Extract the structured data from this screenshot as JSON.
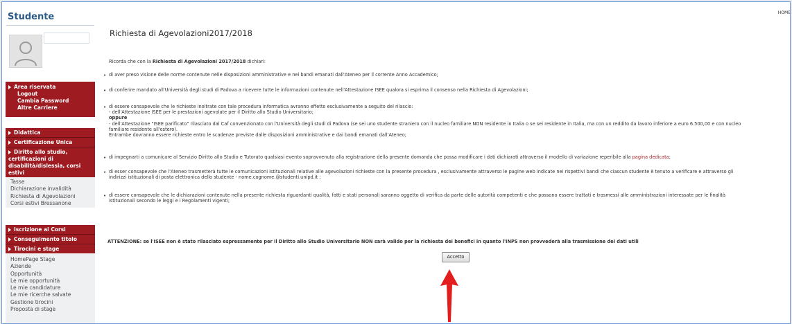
{
  "sidebar": {
    "title": "Studente",
    "area_riservata": {
      "label": "Area riservata",
      "items": [
        "Logout",
        "Cambia Password",
        "Altre Carriere"
      ]
    },
    "menu": [
      {
        "label": "Didattica"
      },
      {
        "label": "Certificazione Unica"
      },
      {
        "label": "Diritto allo studio, certificazioni di disabilità/dislessia, corsi estivi"
      }
    ],
    "diritto_items": [
      "Tasse",
      "Dichiarazione invalidità",
      "Richiesta di Agevolazioni",
      "Corsi estivi Bressanone"
    ],
    "menu2": [
      {
        "label": "Iscrizione ai Corsi"
      },
      {
        "label": "Conseguimento titolo"
      },
      {
        "label": "Tirocini e stage"
      }
    ],
    "tirocini_items": [
      "HomePage Stage",
      "Aziende",
      "Opportunità",
      "Le mie opportunità",
      "Le mie candidature",
      "Le mie ricerche salvate",
      "Gestione tirocini",
      "Proposta di stage"
    ]
  },
  "header": {
    "home": "HOME"
  },
  "main": {
    "title": "Richiesta di Agevolazioni2017/2018",
    "intro_prefix": "Ricorda che con la ",
    "intro_bold": "Richiesta di Agevolazioni 2017/2018",
    "intro_suffix": " dichiari:",
    "b1": "di aver preso visione delle norme contenute nelle disposizioni amministrative e nei bandi emanati dall'Ateneo per il corrente Anno Accademico;",
    "b2": "di conferire mandato all'Università degli studi di Padova a ricevere tutte le informazioni contenute nell'Attestazione ISEE qualora si esprima il consenso nella Richiesta di Agevolazioni;",
    "b3_l1": "di essere consapevole che le richieste inoltrate con tale procedura informatica avranno effetto esclusivamente a seguito del rilascio:",
    "b3_l2": "- dell'Attestazione ISEE per le prestazioni agevolate per il Diritto allo Studio Universitario;",
    "b3_l3": "oppure",
    "b3_l4": "- dell'Attestazione \"ISEE parificato\" rilasciato dal Caf convenzionato con l'Università degli studi di Padova (se sei uno studente straniero con il nucleo familiare NON residente in Italia o se sei residente in Italia, ma con un reddito da lavoro inferiore a euro 6.500,00 e con nucleo",
    "b3_l5": "familiare residente all'estero).",
    "b3_l6": "Entrambe dovranno essere richieste entro le scadenze previste dalle disposizioni amministrative e dai bandi emanati dall'Ateneo;",
    "b4_text": "di impegnarti a comunicare al Servizio Diritto allo Studio e Tutorato qualsiasi evento sopravvenuto alla registrazione della presente domanda che possa modificare i dati dichiarati attraverso il modello di variazione reperibile alla ",
    "b4_link": "pagina dedicata",
    "b4_end": ";",
    "b5_l1": "di esser consapevole che l'Ateneo trasmetterà tutte le comunicazioni istituzionali relative alle agevolazioni richieste con la presente procedura , esclusivamente attraverso le pagine web indicate nei rispettivi bandi che ciascun studente è tenuto a verificare e attraverso gli",
    "b5_l2": "indirizzi istituzionali di posta elettronica dello studente - nome.cognome.@studenti.unipd.it ;",
    "b6_l1": "di essere consapevole che le dichiarazioni contenute nella presente richiesta riguardanti qualità, fatti e stati personali saranno oggetto di verifica da parte delle autorità competenti e che possono essere trattati e trasmessi alle amministrazioni interessate per le finalità",
    "b6_l2": "istituzionali secondo le leggi e i Regolamenti vigenti;",
    "attention": "ATTENZIONE: se l'ISEE non è stato rilasciato espressamente per il Diritto allo Studio Universitario NON sarà valido per la richiesta dei benefici in quanto l'INPS non provvederà alla trasmissione dei dati utili",
    "accept_button": "Accetto"
  },
  "colors": {
    "menu_red": "#9d1b21",
    "title_blue": "#2e5b86",
    "arrow_red": "#e31e1e"
  }
}
